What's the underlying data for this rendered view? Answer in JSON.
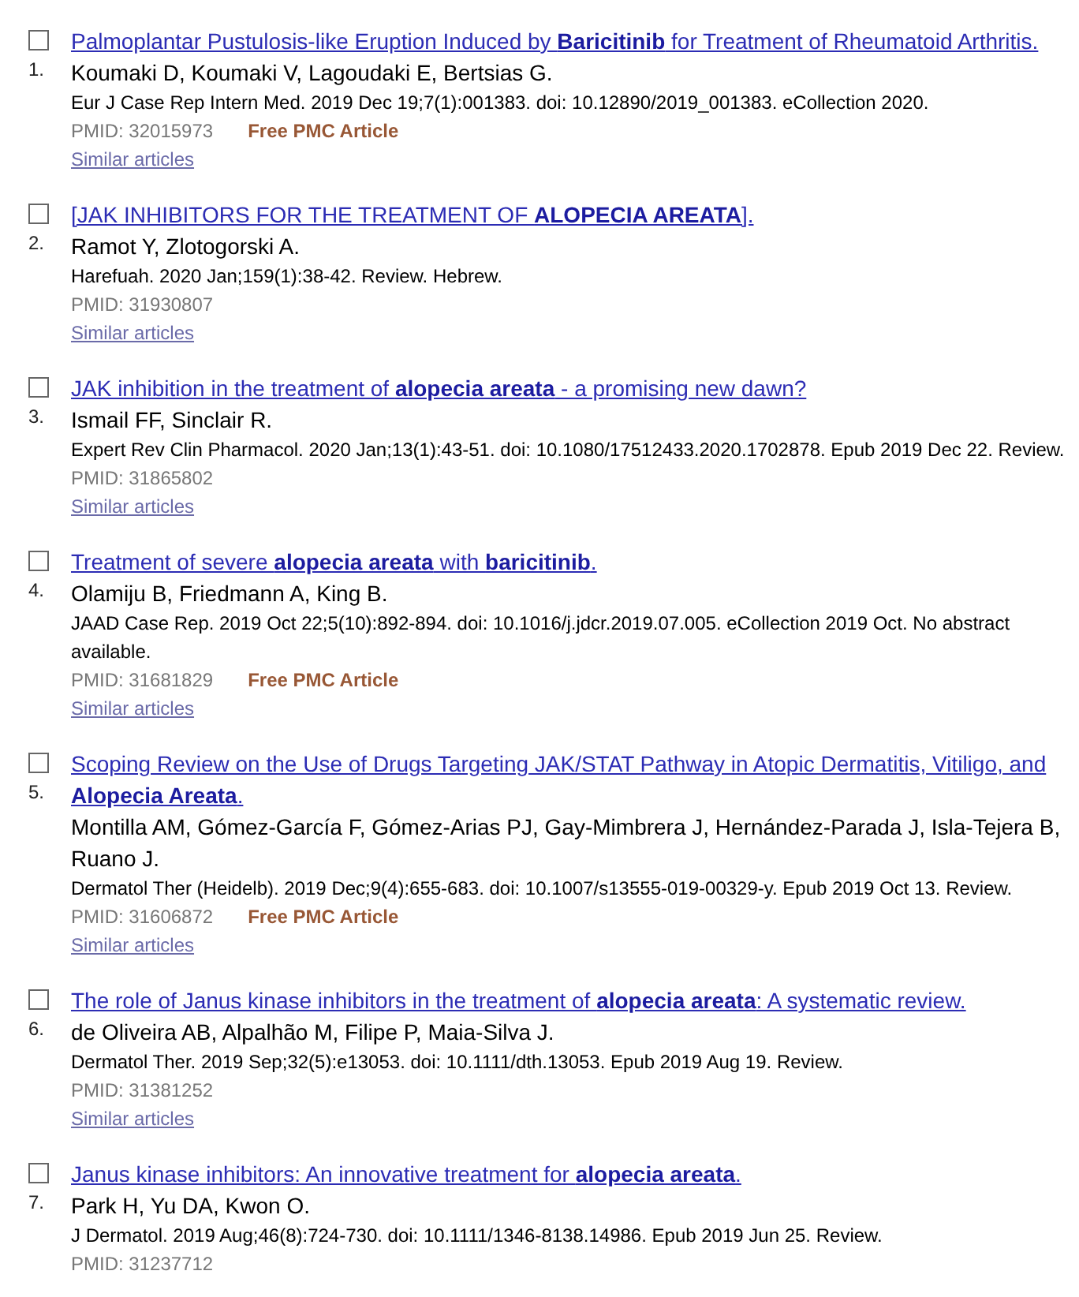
{
  "results": [
    {
      "number": "1.",
      "checked": false,
      "title": "Palmoplantar Pustulosis-like Eruption Induced by **Baricitinib** for Treatment of Rheumatoid Arthritis.",
      "authors": "Koumaki D, Koumaki V, Lagoudaki E, Bertsias G.",
      "citation": "Eur J Case Rep Intern Med. 2019 Dec 19;7(1):001383. doi: 10.12890/2019_001383. eCollection 2020.",
      "pmid": "PMID: 32015973",
      "free_pmc": "Free PMC Article",
      "similar": "Similar articles"
    },
    {
      "number": "2.",
      "checked": false,
      "title": "[JAK INHIBITORS FOR THE TREATMENT OF **ALOPECIA AREATA**].",
      "authors": "Ramot Y, Zlotogorski A.",
      "citation": "Harefuah. 2020 Jan;159(1):38-42. Review. Hebrew.",
      "pmid": "PMID: 31930807",
      "similar": "Similar articles"
    },
    {
      "number": "3.",
      "checked": false,
      "title": "JAK inhibition in the treatment of **alopecia areata** - a promising new dawn?",
      "authors": "Ismail FF, Sinclair R.",
      "citation": "Expert Rev Clin Pharmacol. 2020 Jan;13(1):43-51. doi: 10.1080/17512433.2020.1702878. Epub 2019 Dec 22. Review.",
      "pmid": "PMID: 31865802",
      "similar": "Similar articles"
    },
    {
      "number": "4.",
      "checked": false,
      "title": "Treatment of severe **alopecia areata** with **baricitinib**.",
      "authors": "Olamiju B, Friedmann A, King B.",
      "citation": "JAAD Case Rep. 2019 Oct 22;5(10):892-894. doi: 10.1016/j.jdcr.2019.07.005. eCollection 2019 Oct. No abstract available.",
      "pmid": "PMID: 31681829",
      "free_pmc": "Free PMC Article",
      "similar": "Similar articles"
    },
    {
      "number": "5.",
      "checked": false,
      "title": "Scoping Review on the Use of Drugs Targeting JAK/STAT Pathway in Atopic Dermatitis, Vitiligo, and **Alopecia Areata**.",
      "authors": "Montilla AM, Gómez-García F, Gómez-Arias PJ, Gay-Mimbrera J, Hernández-Parada J, Isla-Tejera B, Ruano J.",
      "citation": "Dermatol Ther (Heidelb). 2019 Dec;9(4):655-683. doi: 10.1007/s13555-019-00329-y. Epub 2019 Oct 13. Review.",
      "pmid": "PMID: 31606872",
      "free_pmc": "Free PMC Article",
      "similar": "Similar articles"
    },
    {
      "number": "6.",
      "checked": false,
      "title": "The role of Janus kinase inhibitors in the treatment of **alopecia areata**: A systematic review.",
      "authors": "de Oliveira AB, Alpalhão M, Filipe P, Maia-Silva J.",
      "citation": "Dermatol Ther. 2019 Sep;32(5):e13053. doi: 10.1111/dth.13053. Epub 2019 Aug 19. Review.",
      "pmid": "PMID: 31381252",
      "similar": "Similar articles"
    },
    {
      "number": "7.",
      "checked": false,
      "title": "Janus kinase inhibitors: An innovative treatment for **alopecia areata**.",
      "authors": "Park H, Yu DA, Kwon O.",
      "citation": "J Dermatol. 2019 Aug;46(8):724-730. doi: 10.1111/1346-8138.14986. Epub 2019 Jun 25. Review.",
      "pmid": "PMID: 31237712"
    }
  ]
}
